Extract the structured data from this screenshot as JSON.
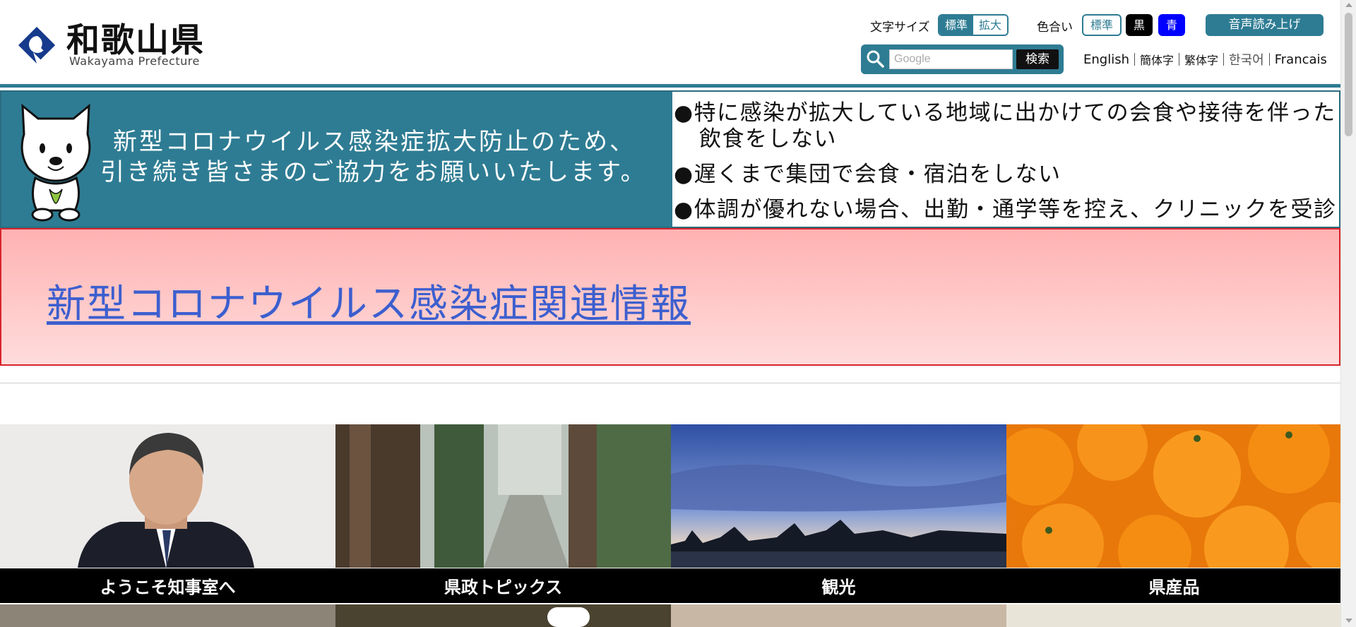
{
  "header": {
    "logo_ja": "和歌山県",
    "logo_en": "Wakayama Prefecture",
    "font_size": {
      "label": "文字サイズ",
      "options": [
        "標準",
        "拡大"
      ],
      "selected": "標準"
    },
    "color_scheme": {
      "label": "色合い",
      "options": [
        "標準",
        "黒",
        "青"
      ],
      "selected": "標準"
    },
    "read_aloud_label": "音声読み上げ",
    "search": {
      "placeholder": "Google",
      "button_label": "検索"
    },
    "languages": [
      "English",
      "簡体字",
      "繁体字",
      "한국어",
      "Francais"
    ],
    "colors": {
      "accent": "#2e7c93",
      "black": "#000000",
      "blue": "#0000ff"
    }
  },
  "corona_banner": {
    "message_line1": "新型コロナウイルス感染症拡大防止のため、",
    "message_line2": "引き続き皆さまのご協力をお願いいたします。",
    "bullets": [
      "●特に感染が拡大している地域に出かけての会食や接待を伴った飲食をしない",
      "●遅くまで集団で会食・宿泊をしない",
      "●体調が優れない場合、出勤・通学等を控え、クリニックを受診"
    ]
  },
  "info_link": {
    "label": "新型コロナウイルス感染症関連情報",
    "color": "#3c5fcf"
  },
  "tiles": [
    {
      "label": "ようこそ知事室へ",
      "image": "governor-portrait"
    },
    {
      "label": "県政トピックス",
      "image": "cedar-forest-path"
    },
    {
      "label": "観光",
      "image": "sunset-rocks-seascape"
    },
    {
      "label": "県産品",
      "image": "mandarin-oranges"
    }
  ]
}
